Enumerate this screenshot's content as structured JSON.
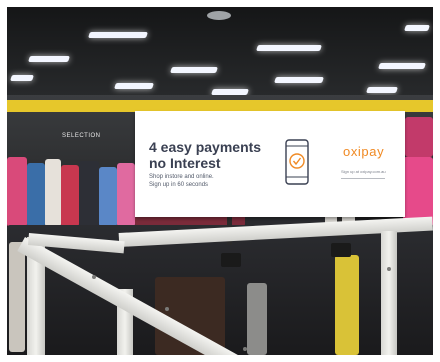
{
  "sign": {
    "headline_line1": "4 easy payments",
    "headline_line2": "no Interest",
    "sub_line1": "Shop instore and online.",
    "sub_line2": "Sign up in 60 seconds",
    "brand": "oxipay",
    "brand_sub": "Sign up at oxipay.com.au"
  },
  "store": {
    "wall_text": "SELECTION"
  },
  "colors": {
    "brand_orange": "#f08a24",
    "headline_navy": "#3a4052",
    "wall_yellow": "#e6c72b",
    "icon": "phone-check-icon"
  }
}
